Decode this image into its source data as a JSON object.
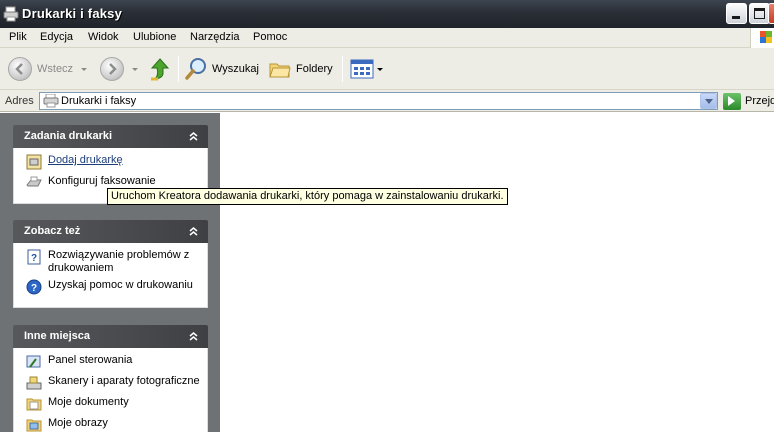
{
  "window": {
    "title": "Drukarki i faksy"
  },
  "menu": [
    "Plik",
    "Edycja",
    "Widok",
    "Ulubione",
    "Narzędzia",
    "Pomoc"
  ],
  "toolbar": {
    "back_label": "Wstecz",
    "search_label": "Wyszukaj",
    "folders_label": "Foldery"
  },
  "address": {
    "label": "Adres",
    "value": "Drukarki i faksy",
    "go_label": "Przejdź"
  },
  "panels": {
    "printer_tasks": {
      "title": "Zadania drukarki",
      "items": [
        "Dodaj drukarkę",
        "Konfiguruj faksowanie"
      ]
    },
    "see_also": {
      "title": "Zobacz też",
      "items": [
        "Rozwiązywanie problemów z drukowaniem",
        "Uzyskaj pomoc w drukowaniu"
      ]
    },
    "other_places": {
      "title": "Inne miejsca",
      "items": [
        "Panel sterowania",
        "Skanery i aparaty fotograficzne",
        "Moje dokumenty",
        "Moje obrazy"
      ]
    }
  },
  "tooltip": "Uruchom Kreatora dodawania drukarki, który pomaga w zainstalowaniu drukarki.",
  "colors": {
    "link": "#1c3e7a",
    "task_pane": "#6f7275",
    "panel_header": "#4a4c4f",
    "tooltip_bg": "#ffffe1"
  }
}
